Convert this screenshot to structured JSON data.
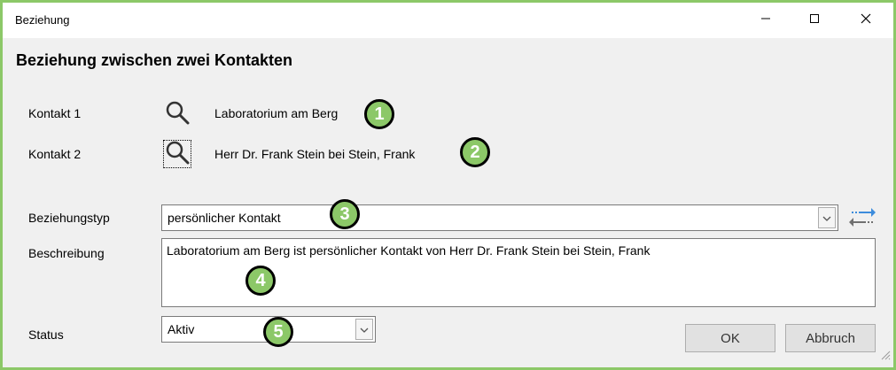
{
  "window": {
    "title": "Beziehung",
    "controls": [
      "minimize-icon",
      "maximize-icon",
      "close-icon"
    ]
  },
  "heading": "Beziehung zwischen zwei Kontakten",
  "contact1": {
    "label": "Kontakt 1",
    "value": "Laboratorium am Berg",
    "icon": "search-icon"
  },
  "contact2": {
    "label": "Kontakt 2",
    "value": "Herr Dr. Frank Stein bei Stein, Frank",
    "icon": "search-icon"
  },
  "relation_type": {
    "label": "Beziehungstyp",
    "value": "persönlicher Kontakt",
    "swap_icon": "swap-direction-icon"
  },
  "description": {
    "label": "Beschreibung",
    "value": "Laboratorium am Berg ist persönlicher Kontakt von Herr Dr. Frank Stein bei Stein, Frank"
  },
  "status": {
    "label": "Status",
    "value": "Aktiv"
  },
  "buttons": {
    "ok": "OK",
    "cancel": "Abbruch"
  },
  "badges": [
    "1",
    "2",
    "3",
    "4",
    "5"
  ],
  "colors": {
    "highlight": "#8cc868",
    "swap_arrow_blue": "#3c8cdc",
    "swap_arrow_gray": "#707070"
  }
}
